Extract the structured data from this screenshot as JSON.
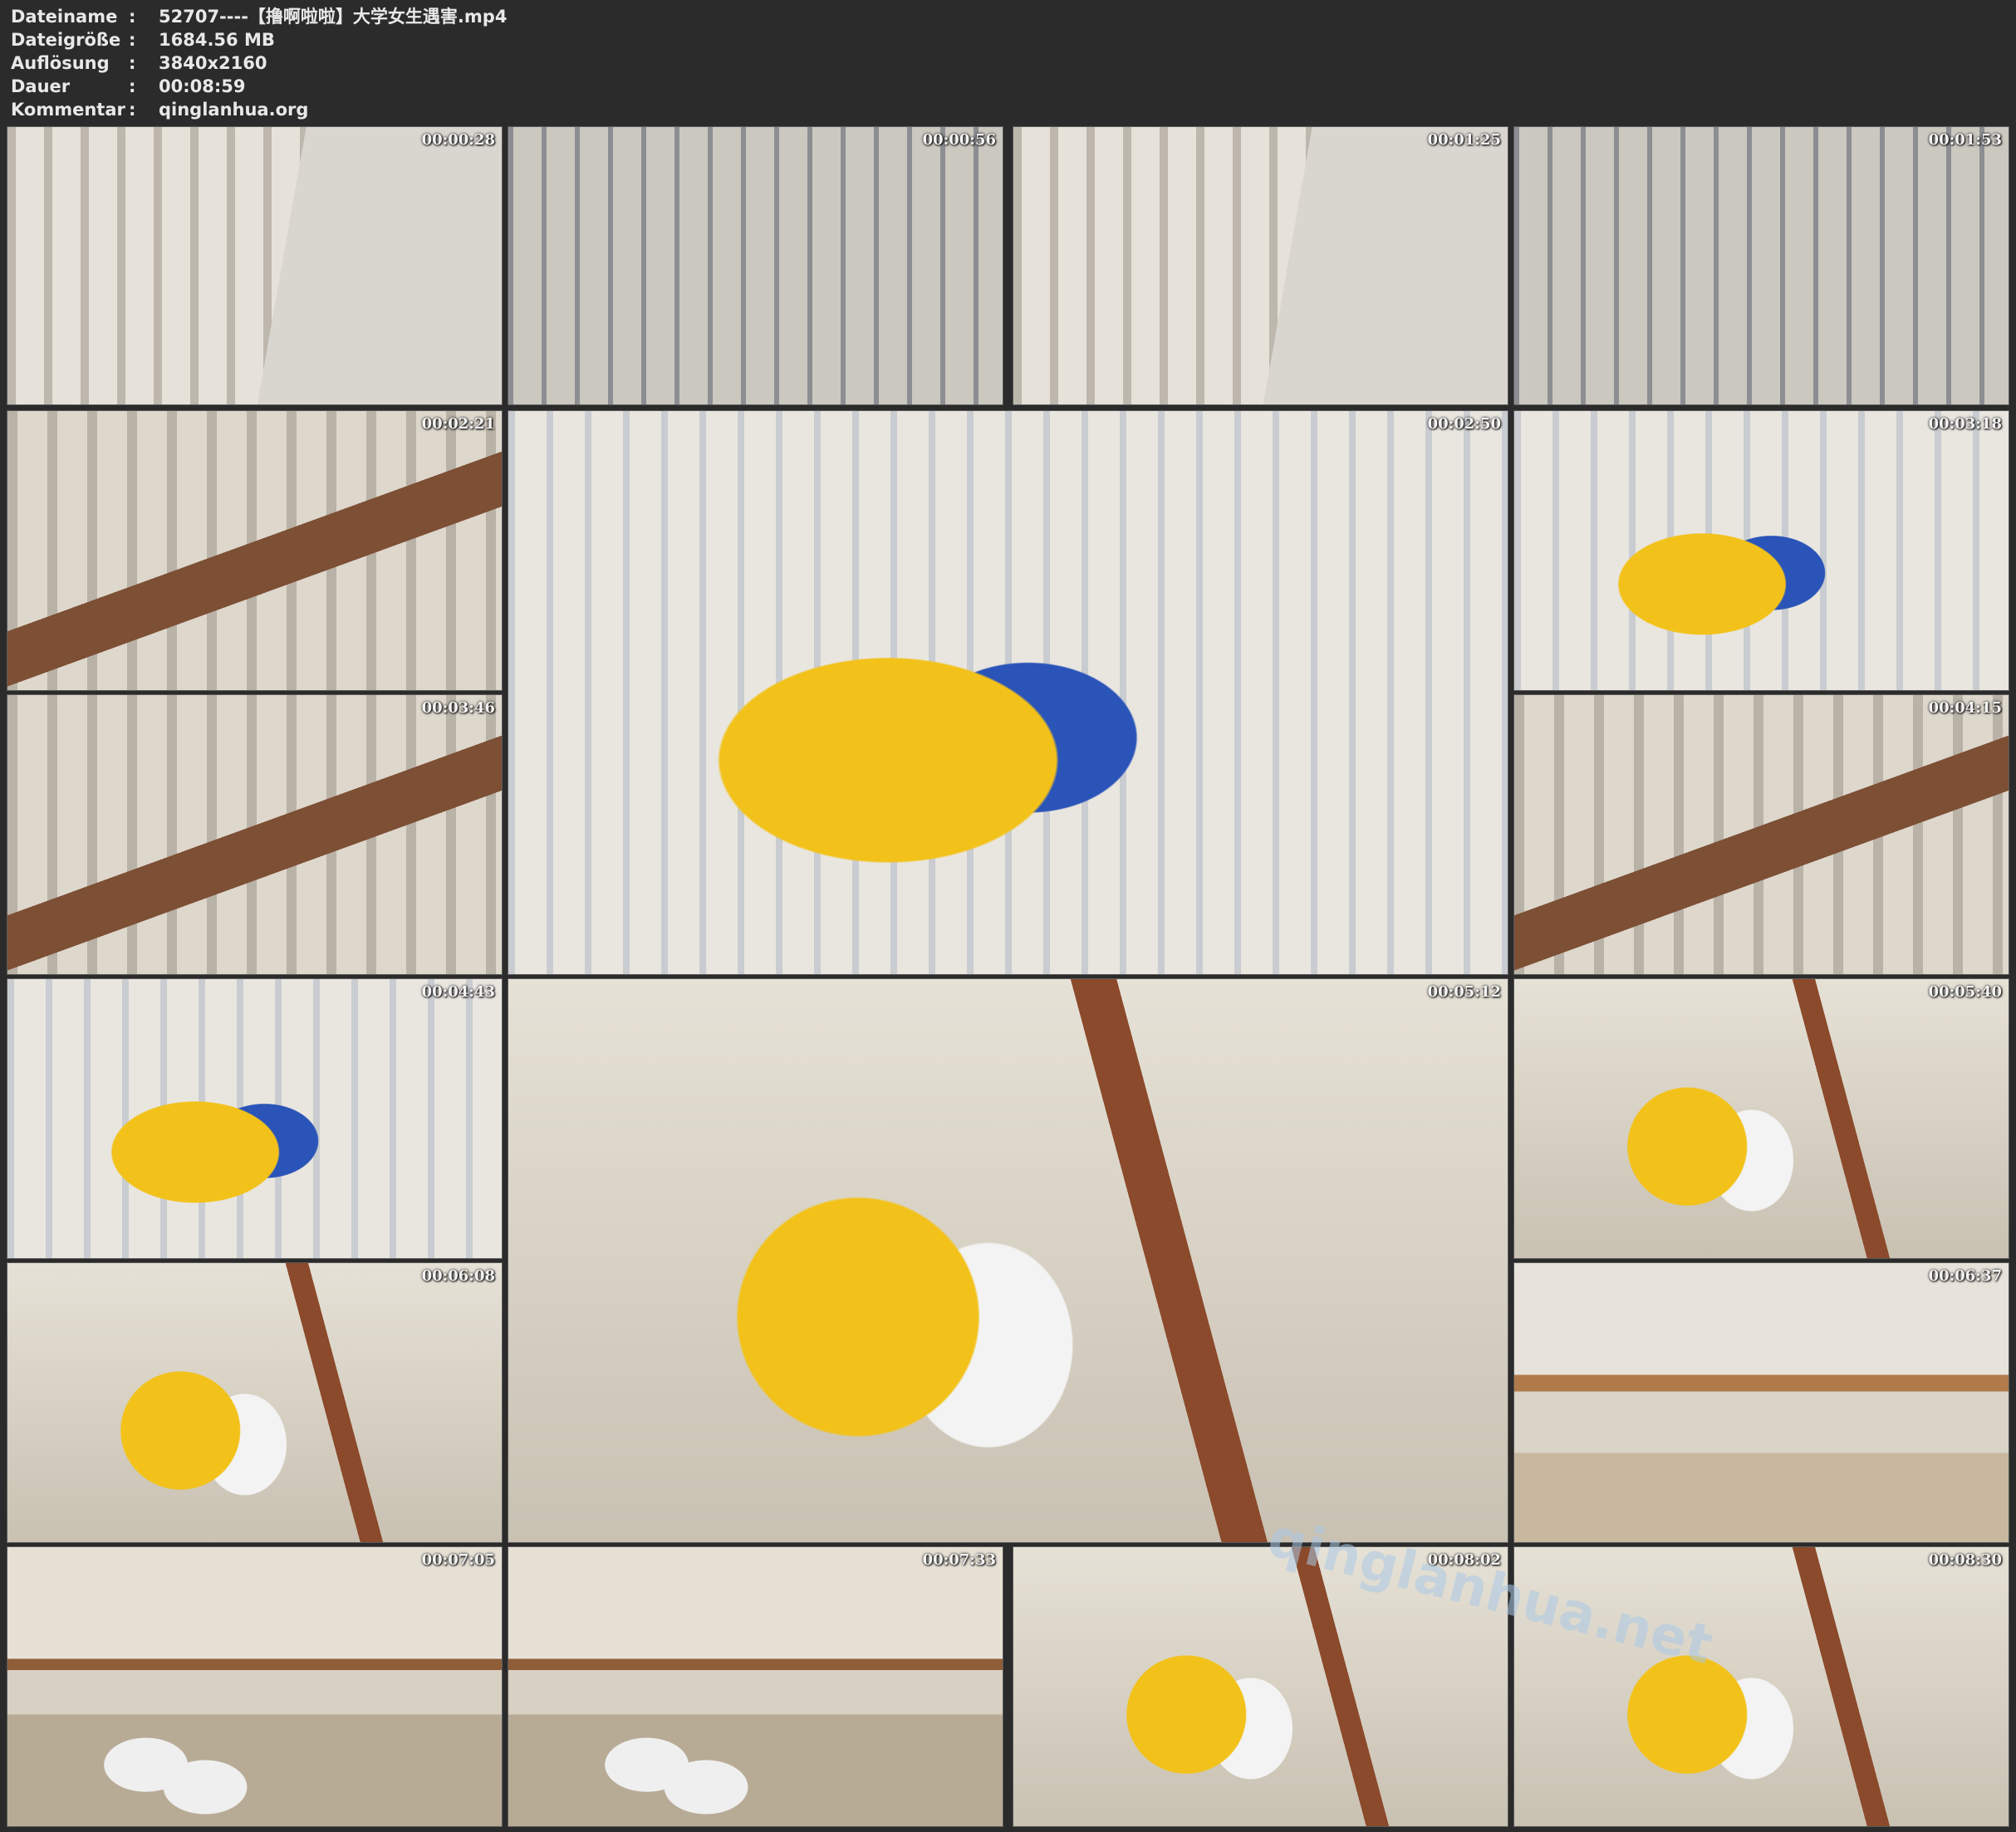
{
  "info": {
    "rows": [
      {
        "label": "Dateiname",
        "sep": ":",
        "value": "52707----【撸啊啦啦】大学女生遇害.mp4"
      },
      {
        "label": "Dateigröße",
        "sep": ":",
        "value": "1684.56 MB"
      },
      {
        "label": "Auflösung",
        "sep": ":",
        "value": "3840x2160"
      },
      {
        "label": "Dauer",
        "sep": ":",
        "value": "00:08:59"
      },
      {
        "label": "Kommentar",
        "sep": ":",
        "value": "qinglanhua.org"
      }
    ]
  },
  "thumbnails": [
    {
      "timestamp": "00:00:28",
      "scene": "stairs-window"
    },
    {
      "timestamp": "00:00:56",
      "scene": "stairs-figure"
    },
    {
      "timestamp": "00:01:25",
      "scene": "stairs-window"
    },
    {
      "timestamp": "00:01:53",
      "scene": "stairs-figure"
    },
    {
      "timestamp": "00:02:21",
      "scene": "stairs-closeup"
    },
    {
      "timestamp": "00:02:50",
      "scene": "jacket-window"
    },
    {
      "timestamp": "00:03:18",
      "scene": "jacket-window"
    },
    {
      "timestamp": "00:03:46",
      "scene": "stairs-closeup"
    },
    {
      "timestamp": "00:04:15",
      "scene": "stairs-closeup"
    },
    {
      "timestamp": "00:04:43",
      "scene": "jacket-window"
    },
    {
      "timestamp": "00:05:12",
      "scene": "jacket-stairs"
    },
    {
      "timestamp": "00:05:40",
      "scene": "jacket-stairs"
    },
    {
      "timestamp": "00:06:08",
      "scene": "jacket-stairs"
    },
    {
      "timestamp": "00:06:37",
      "scene": "floor-room"
    },
    {
      "timestamp": "00:07:05",
      "scene": "floor-socks"
    },
    {
      "timestamp": "00:07:33",
      "scene": "floor-socks"
    },
    {
      "timestamp": "00:08:02",
      "scene": "jacket-stairs"
    },
    {
      "timestamp": "00:08:30",
      "scene": "jacket-stairs"
    }
  ],
  "watermark": {
    "text": "qinglanhua.net"
  },
  "colors": {
    "background": "#2b2b2b",
    "header_text": "#e8e8e8",
    "timestamp_text": "#f4f4f4",
    "jacket_yellow": "#f2c21b",
    "jacket_blue": "#2a54b8",
    "rail_brown": "#8b4a2b"
  }
}
